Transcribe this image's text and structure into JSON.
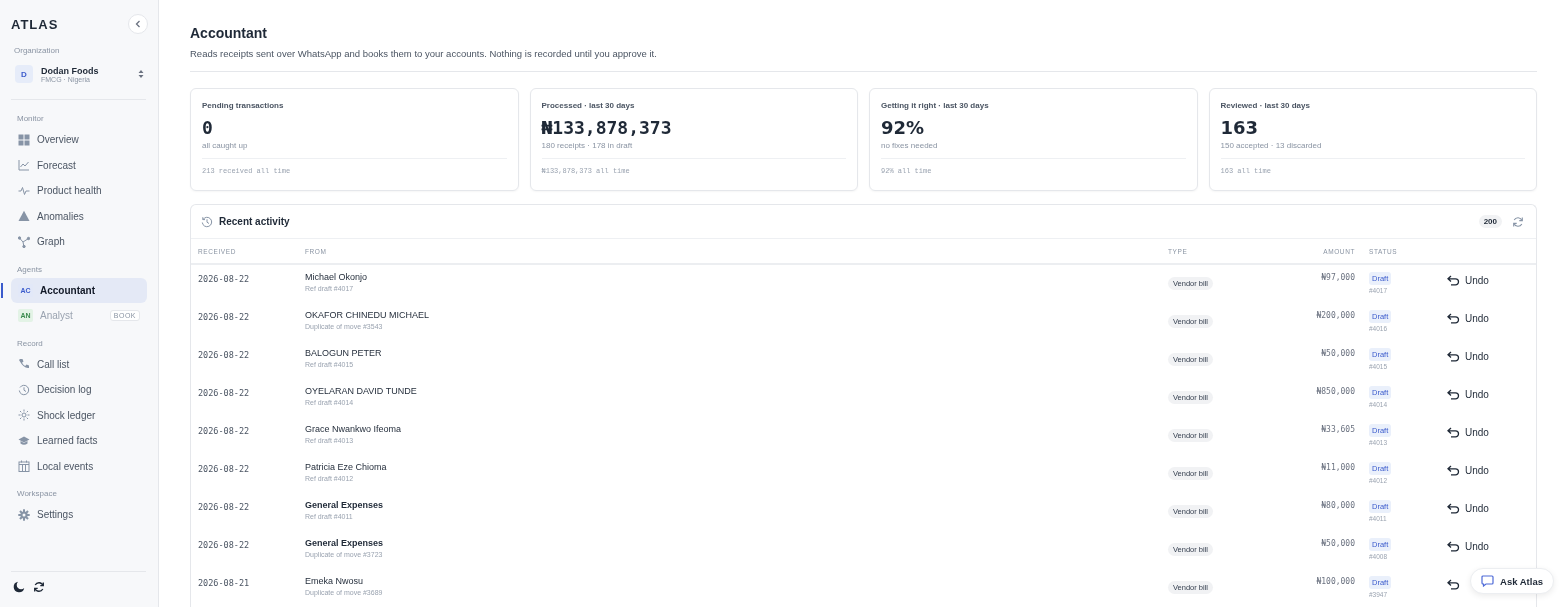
{
  "sidebar": {
    "logo": "ATLAS",
    "org_label": "Organization",
    "org": {
      "initial": "D",
      "name": "Dodan Foods",
      "sub": "FMCG · Nigeria"
    },
    "sections": [
      {
        "title": "Monitor",
        "items": [
          {
            "label": "Overview",
            "selected": false,
            "disabled": false
          },
          {
            "label": "Forecast",
            "selected": false,
            "disabled": false
          },
          {
            "label": "Product health",
            "selected": false,
            "disabled": false
          },
          {
            "label": "Anomalies",
            "selected": false,
            "disabled": false
          },
          {
            "label": "Graph",
            "selected": false,
            "disabled": false
          }
        ]
      },
      {
        "title": "Agents",
        "items": [
          {
            "label": "Accountant",
            "avatar": "AC",
            "selected": true,
            "disabled": false
          },
          {
            "label": "Analyst",
            "avatar": "AN",
            "badge": "BOOK",
            "selected": false,
            "disabled": true
          }
        ]
      },
      {
        "title": "Record",
        "items": [
          {
            "label": "Call list",
            "selected": false,
            "disabled": false
          },
          {
            "label": "Decision log",
            "selected": false,
            "disabled": false
          },
          {
            "label": "Shock ledger",
            "selected": false,
            "disabled": false
          },
          {
            "label": "Learned facts",
            "selected": false,
            "disabled": false
          },
          {
            "label": "Local events",
            "selected": false,
            "disabled": false
          }
        ]
      },
      {
        "title": "Workspace",
        "items": [
          {
            "label": "Settings",
            "selected": false,
            "disabled": false
          }
        ]
      }
    ]
  },
  "header": {
    "title": "Accountant",
    "subtitle": "Reads receipts sent over WhatsApp and books them to your accounts. Nothing is recorded until you approve it."
  },
  "stats": [
    {
      "label": "Pending transactions",
      "value": "0",
      "note": "all caught up",
      "footer": "213 received all time"
    },
    {
      "label": "Processed · last 30 days",
      "value": "₦133,878,373",
      "note": "180 receipts · 178 in draft",
      "footer": "₦133,878,373 all time"
    },
    {
      "label": "Getting it right · last 30 days",
      "value": "92%",
      "note": "no fixes needed",
      "footer": "92% all time"
    },
    {
      "label": "Reviewed · last 30 days",
      "value": "163",
      "note": "150 accepted · 13 discarded",
      "footer": "163 all time"
    }
  ],
  "activity": {
    "title": "Recent activity",
    "count": "200",
    "columns": [
      "RECEIVED",
      "FROM",
      "TYPE",
      "AMOUNT",
      "STATUS"
    ],
    "rows": [
      {
        "received": "2026-08-22",
        "from": "Michael Okonjo",
        "kind": "person",
        "ref": "Ref draft #4017",
        "type": "Vendor bill",
        "amount": "₦97,000",
        "status": "Draft",
        "number": "#4017",
        "undo": "Undo"
      },
      {
        "received": "2026-08-22",
        "from": "OKAFOR CHINEDU MICHAEL",
        "kind": "person",
        "ref": "Duplicate of move #3543",
        "type": "Vendor bill",
        "amount": "₦200,000",
        "status": "Draft",
        "number": "#4016",
        "undo": "Undo"
      },
      {
        "received": "2026-08-22",
        "from": "BALOGUN PETER",
        "kind": "person",
        "ref": "Ref draft #4015",
        "type": "Vendor bill",
        "amount": "₦50,000",
        "status": "Draft",
        "number": "#4015",
        "undo": "Undo"
      },
      {
        "received": "2026-08-22",
        "from": "OYELARAN DAVID TUNDE",
        "kind": "person",
        "ref": "Ref draft #4014",
        "type": "Vendor bill",
        "amount": "₦850,000",
        "status": "Draft",
        "number": "#4014",
        "undo": "Undo"
      },
      {
        "received": "2026-08-22",
        "from": "Grace Nwankwo Ifeoma",
        "kind": "person",
        "ref": "Ref draft #4013",
        "type": "Vendor bill",
        "amount": "₦33,605",
        "status": "Draft",
        "number": "#4013",
        "undo": "Undo"
      },
      {
        "received": "2026-08-22",
        "from": "Patricia Eze Chioma",
        "kind": "person",
        "ref": "Ref draft #4012",
        "type": "Vendor bill",
        "amount": "₦11,000",
        "status": "Draft",
        "number": "#4012",
        "undo": "Undo"
      },
      {
        "received": "2026-08-22",
        "from": "General Expenses",
        "kind": "account",
        "ref": "Ref draft #4011",
        "type": "Vendor bill",
        "amount": "₦80,000",
        "status": "Draft",
        "number": "#4011",
        "undo": "Undo"
      },
      {
        "received": "2026-08-22",
        "from": "General Expenses",
        "kind": "account",
        "ref": "Duplicate of move #3723",
        "type": "Vendor bill",
        "amount": "₦50,000",
        "status": "Draft",
        "number": "#4008",
        "undo": "Undo"
      },
      {
        "received": "2026-08-21",
        "from": "Emeka Nwosu",
        "kind": "person",
        "ref": "Duplicate of move #3689",
        "type": "Vendor bill",
        "amount": "₦100,000",
        "status": "Draft",
        "number": "#3947"
      }
    ]
  },
  "ask_button": "Ask Atlas"
}
